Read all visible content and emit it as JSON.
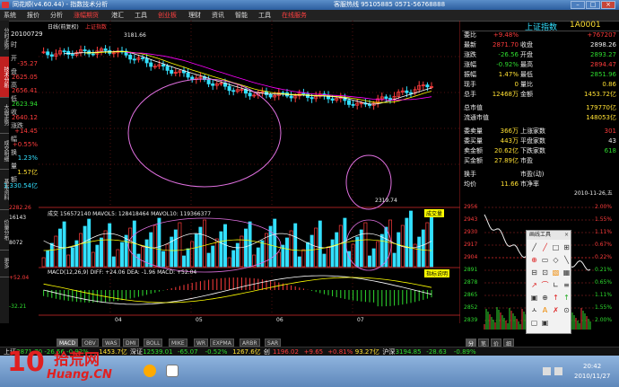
{
  "window": {
    "title": "同花顺(v4.60.44) - 指数技术分析",
    "info": "客服热线 95105885  0571-56768888"
  },
  "menu": {
    "items": [
      {
        "label": "系统"
      },
      {
        "label": "报价"
      },
      {
        "label": "分析"
      },
      {
        "label": "涨幅期货",
        "active": true
      },
      {
        "label": "港汇"
      },
      {
        "label": "工具"
      },
      {
        "label": "创业板",
        "active": true
      },
      {
        "label": "理财"
      },
      {
        "label": "资讯"
      },
      {
        "label": "智能"
      },
      {
        "label": "工具"
      },
      {
        "label": "在线服务",
        "active": true
      }
    ]
  },
  "side_tabs": [
    "分时走势",
    "技术分析",
    "大盘走势",
    "成交明细",
    "基本资料",
    "价量分布",
    "更多"
  ],
  "left_info": {
    "date": "20100729",
    "rows": [
      {
        "label": "时",
        "value": "",
        "color": "white"
      },
      {
        "label": "开",
        "value": "-35.27",
        "color": "red"
      },
      {
        "label": "盘",
        "value": "2625.05",
        "color": "red"
      },
      {
        "label": "高",
        "value": "2656.41",
        "color": "red"
      },
      {
        "label": "低",
        "value": "2623.94",
        "color": "green"
      },
      {
        "label": "收",
        "value": "2640.12",
        "color": "red"
      },
      {
        "label": "涨跌",
        "value": "+14.45",
        "color": "red"
      },
      {
        "label": "幅",
        "value": "+0.55%",
        "color": "red"
      },
      {
        "label": "换",
        "value": "1.23%",
        "color": "cyan"
      },
      {
        "label": "量",
        "value": "1.57亿",
        "color": "yel"
      },
      {
        "label": "额",
        "value": "1,330.54亿",
        "color": "cyan"
      }
    ]
  },
  "chart_header": {
    "period": "日线(前复权)",
    "name": "上证指数",
    "high_label": "3181.66",
    "low_label": "2319.74",
    "vol_line": "成交 156572140  MAVOL5: 128418464  MAVOL10: 119366377",
    "vol_btn": "成交量",
    "vol_ticks": [
      "16143",
      "8072"
    ],
    "macd_line": "MACD(12,26,9) DIFF: +24.06  DEA: -1.96  MACD: +52.04",
    "macd_btn": "指标说明",
    "macd_ticks": [
      "+52.04",
      "-32.21"
    ],
    "xaxis": [
      "04",
      "05",
      "06",
      "07"
    ],
    "price_axis": "2282.26"
  },
  "right_panel": {
    "header_name": "上证指数",
    "header_code": "1A0001",
    "rows": [
      {
        "l": "委比",
        "lv": "+9.48%",
        "lvc": "red",
        "r": "",
        "rv": "+767207",
        "rvc": "red"
      },
      {
        "l": "最新",
        "lv": "2871.70",
        "lvc": "red",
        "r": "收盘",
        "rv": "2898.26",
        "rvc": "white"
      },
      {
        "l": "涨跌",
        "lv": "-26.56",
        "lvc": "green",
        "r": "开盘",
        "rv": "2893.27",
        "rvc": "green"
      },
      {
        "l": "涨幅",
        "lv": "-0.92%",
        "lvc": "green",
        "r": "最高",
        "rv": "2894.47",
        "rvc": "red"
      },
      {
        "l": "振幅",
        "lv": "1.47%",
        "lvc": "yel",
        "r": "最低",
        "rv": "2851.96",
        "rvc": "green"
      },
      {
        "l": "现手",
        "lv": "0",
        "lvc": "yel",
        "r": "量比",
        "rv": "0.86",
        "rvc": "yel"
      },
      {
        "l": "总手",
        "lv": "12468万",
        "lvc": "yel",
        "r": "金额",
        "rv": "1453.72亿",
        "rvc": "yel"
      },
      {
        "l": "总市值",
        "lv": "",
        "lvc": "white",
        "r": "",
        "rv": "179770亿",
        "rvc": "yel"
      },
      {
        "l": "流通市值",
        "lv": "",
        "lvc": "white",
        "r": "",
        "rv": "148053亿",
        "rvc": "yel"
      },
      {
        "l": "委卖量",
        "lv": "366万",
        "lvc": "yel",
        "r": "上涨家数",
        "rv": "301",
        "rvc": "red"
      },
      {
        "l": "委买量",
        "lv": "443万",
        "lvc": "yel",
        "r": "平盘家数",
        "rv": "43",
        "rvc": "white"
      },
      {
        "l": "卖金额",
        "lv": "20.62亿",
        "lvc": "yel",
        "r": "下跌家数",
        "rv": "618",
        "rvc": "green"
      },
      {
        "l": "买金额",
        "lv": "27.89亿",
        "lvc": "yel",
        "r": "市盈",
        "rv": "",
        "rvc": "white"
      },
      {
        "l": "换手",
        "lv": "",
        "lvc": "white",
        "r": "市盈(动)",
        "rv": "",
        "rvc": "white"
      },
      {
        "l": "均价",
        "lv": "11.66",
        "lvc": "yel",
        "r": "市净率",
        "rv": "",
        "rvc": "white"
      }
    ],
    "date_line": "2010-11-26,五"
  },
  "mini_chart": {
    "left_ticks": [
      "2956",
      "2943",
      "2930",
      "2917",
      "2904",
      "2891",
      "2878",
      "2865",
      "2852",
      "2839"
    ],
    "right_ticks": [
      "2.00%",
      "1.55%",
      "1.11%",
      "0.67%",
      "0.22%",
      "0.21%",
      "0.65%",
      "1.11%",
      "1.55%",
      "2.00%"
    ]
  },
  "draw_tools": {
    "title": "画线工具",
    "close": "×"
  },
  "bottom_tabs": [
    {
      "label": "MACD",
      "active": true
    },
    {
      "label": "OBV"
    },
    {
      "label": "WAS"
    },
    {
      "label": "DMI"
    },
    {
      "label": "BOLL"
    },
    {
      "label": "MIKE"
    },
    {
      "label": "WR"
    },
    {
      "label": "EXPMA"
    },
    {
      "label": "ARBR"
    },
    {
      "label": "SAR"
    }
  ],
  "mini_tabs": [
    "分",
    "笔",
    "价",
    "细"
  ],
  "status": [
    {
      "t": "上证",
      "c": "white"
    },
    {
      "t": "2871.70 -26.56 -0.92%",
      "c": "green"
    },
    {
      "t": "1453.7亿",
      "c": "yel"
    },
    {
      "t": "深证",
      "c": "white"
    },
    {
      "t": "12539.01",
      "c": "green"
    },
    {
      "t": "-65.07",
      "c": "green"
    },
    {
      "t": "-0.52%",
      "c": "green"
    },
    {
      "t": "1267.6亿",
      "c": "yel"
    },
    {
      "t": "创",
      "c": "white"
    },
    {
      "t": "1196.02",
      "c": "red"
    },
    {
      "t": "+9.65",
      "c": "red"
    },
    {
      "t": "+0.81%",
      "c": "red"
    },
    {
      "t": "93.27亿",
      "c": "yel"
    },
    {
      "t": "沪深",
      "c": "white"
    },
    {
      "t": "3194.85",
      "c": "green"
    },
    {
      "t": "-28.63",
      "c": "green"
    },
    {
      "t": "-0.89%",
      "c": "green"
    }
  ],
  "taskbar": {
    "time": "20:42",
    "date": "2010/11/27"
  },
  "watermark": {
    "big": "10",
    "cn": "拾荒网",
    "en": "Huang.CN"
  }
}
